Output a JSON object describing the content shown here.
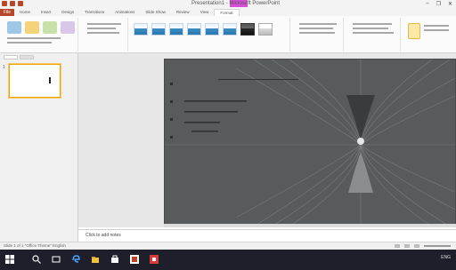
{
  "titlebar": {
    "title": "Presentation1 - Microsoft PowerPoint",
    "context_tab_label": "Picture Tools",
    "win_controls": [
      "–",
      "❐",
      "✕"
    ]
  },
  "tabs": [
    "Home",
    "Insert",
    "Design",
    "Transitions",
    "Animations",
    "Slide Show",
    "Review",
    "View",
    "Format"
  ],
  "file_tab": "File",
  "ribbon": {
    "groups": [
      "Adjust",
      "Picture Styles",
      "Arrange",
      "Size"
    ],
    "picture_styles": [
      "blue",
      "blue",
      "blue",
      "blue",
      "blue",
      "blue",
      "dark",
      "light"
    ]
  },
  "panel": {
    "tabs": [
      "Slides",
      "Outline"
    ],
    "slide_number": "1"
  },
  "notes": {
    "placeholder": "Click to add notes"
  },
  "statusbar": {
    "left": "Slide 1 of 1    \"Office Theme\"    English"
  },
  "taskbar": {
    "tray_text": "ENG",
    "icons": [
      "windows-start",
      "search",
      "task-view",
      "edge",
      "file-explorer",
      "store",
      "powerpoint",
      "app"
    ]
  },
  "colors": {
    "accent": "#b7472a",
    "context": "#d64fd6",
    "slide_bg": "#555759",
    "taskbar": "#1f1f2b"
  }
}
